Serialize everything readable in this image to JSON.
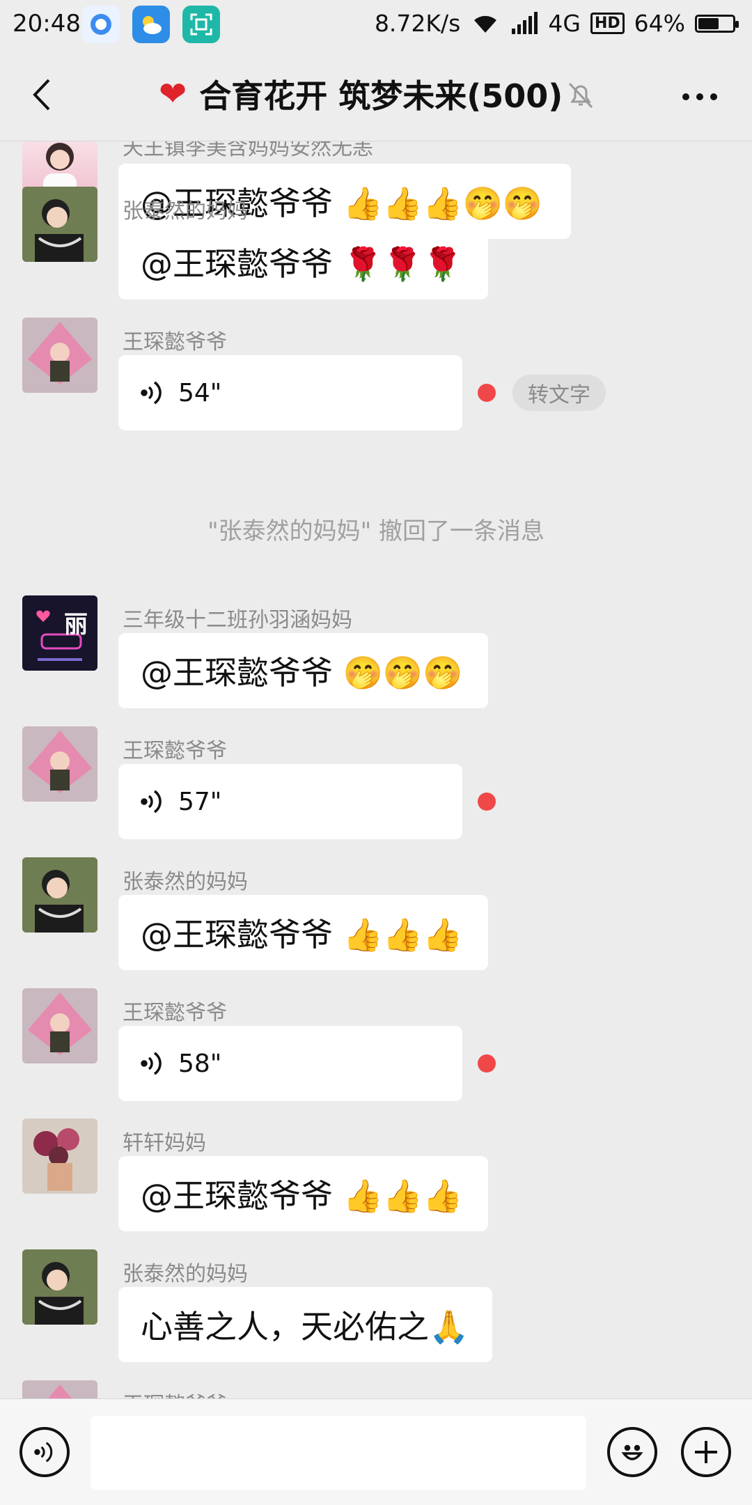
{
  "status_bar": {
    "time": "20:48",
    "net_speed": "8.72K/s",
    "network": "4G",
    "hd": "HD",
    "battery": "64%",
    "battery_level": 0.64
  },
  "header": {
    "title": "合育花开 筑梦未来(500)",
    "heart_icon": "❤"
  },
  "messages": [
    {
      "sender": "天王镇李美含妈妈安然无恙",
      "text": "@王琛懿爷爷 👍👍👍🤭🤭"
    },
    {
      "sender": "张泰然的妈妈",
      "text": "@王琛懿爷爷 🌹🌹🌹"
    },
    {
      "sender": "王琛懿爷爷",
      "voice": "54\"",
      "to_text": "转文字"
    },
    {
      "system": "\"张泰然的妈妈\" 撤回了一条消息"
    },
    {
      "sender": "三年级十二班孙羽涵妈妈",
      "text": "@王琛懿爷爷 🤭🤭🤭"
    },
    {
      "sender": "王琛懿爷爷",
      "voice": "57\""
    },
    {
      "sender": "张泰然的妈妈",
      "text": "@王琛懿爷爷 👍👍👍"
    },
    {
      "sender": "王琛懿爷爷",
      "voice": "58\""
    },
    {
      "sender": "轩轩妈妈",
      "text": "@王琛懿爷爷 👍👍👍"
    },
    {
      "sender": "张泰然的妈妈",
      "text": "心善之人，天必佑之🙏"
    },
    {
      "sender": "王琛懿爷爷"
    }
  ],
  "avatar_text": "丽",
  "colors": {
    "accent_red": "#f04848",
    "background": "#ececec"
  }
}
